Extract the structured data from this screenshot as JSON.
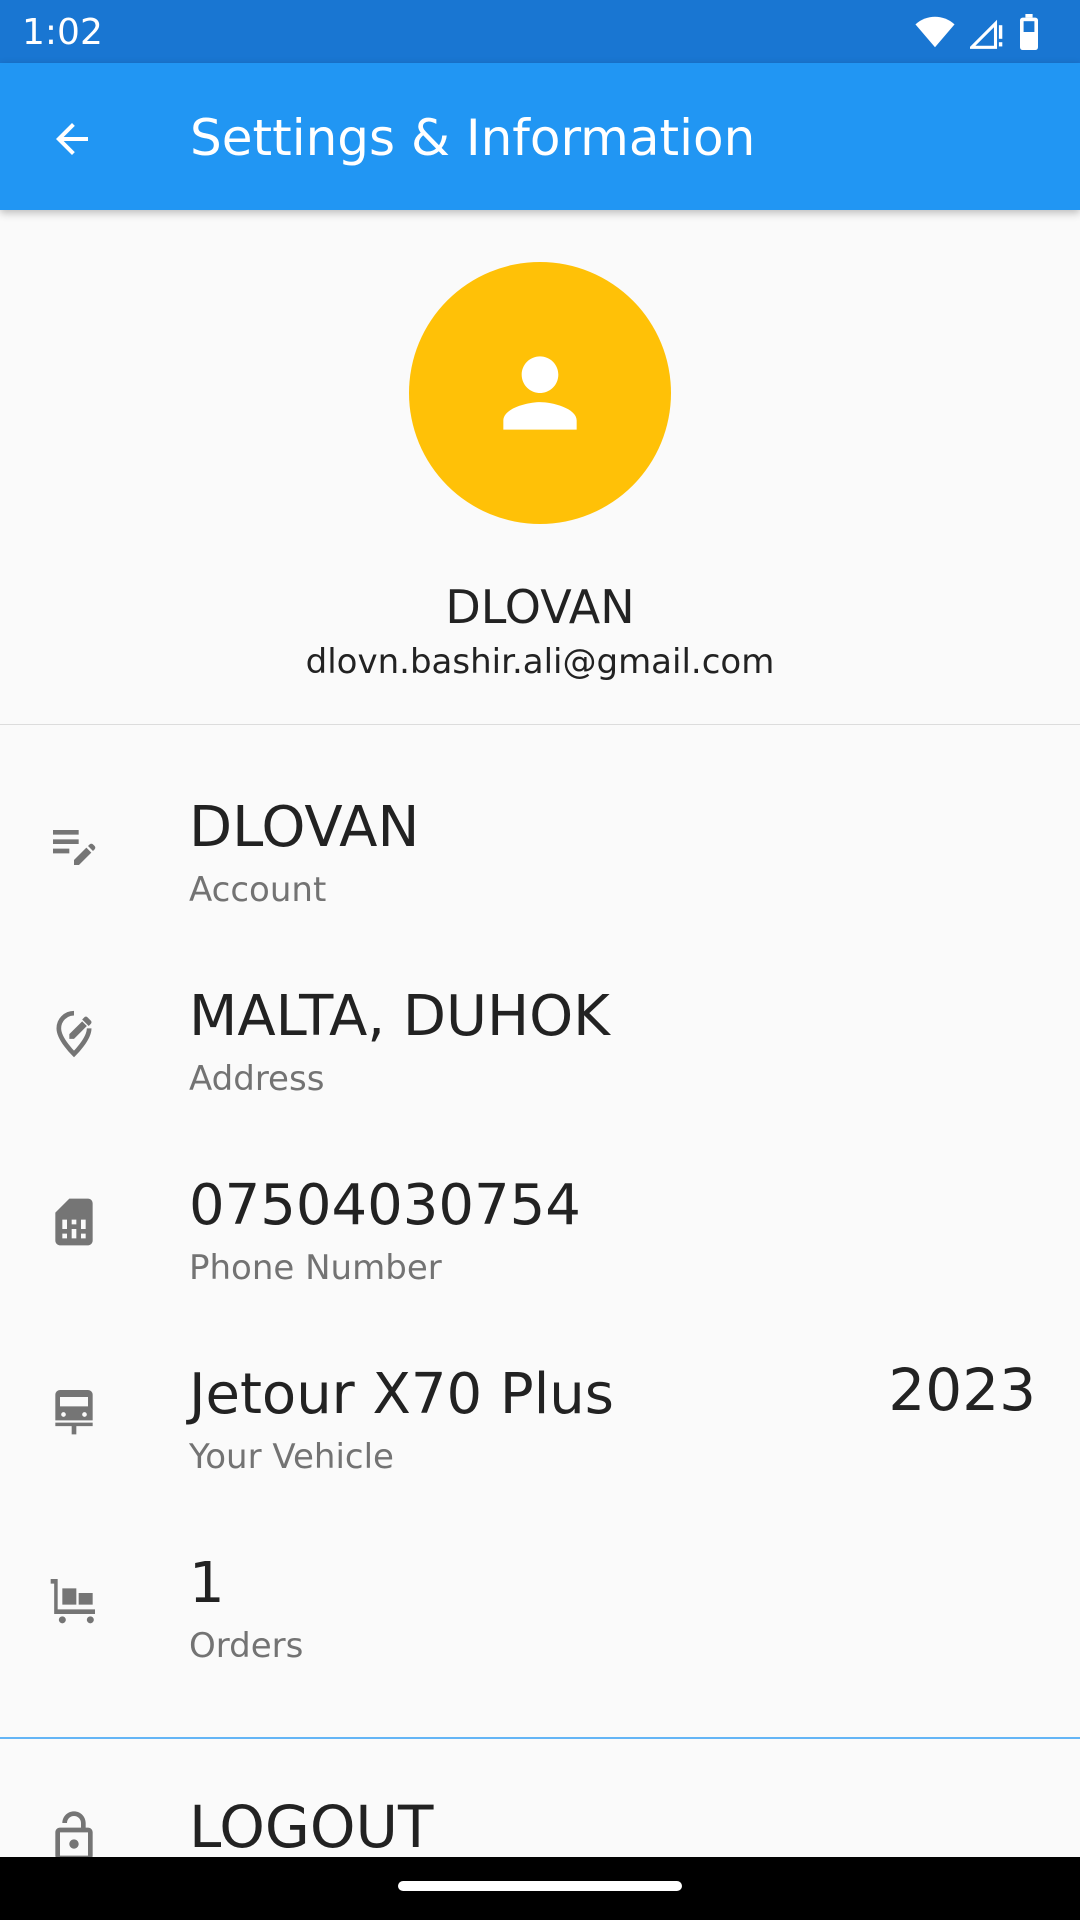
{
  "status_bar": {
    "time": "1:02",
    "icons": [
      "wifi-icon",
      "signal-icon",
      "battery-icon"
    ]
  },
  "app_bar": {
    "title": "Settings & Information",
    "back_icon": "arrow-back-icon",
    "background": "#2196f3"
  },
  "profile": {
    "avatar_icon": "person-icon",
    "avatar_color": "#ffc107",
    "name": "DLOVAN",
    "email": "dlovn.bashir.ali@gmail.com"
  },
  "info_items": [
    {
      "icon": "edit-note-icon",
      "value": "DLOVAN",
      "label": "Account"
    },
    {
      "icon": "edit-location-icon",
      "value": "MALTA, DUHOK",
      "label": "Address"
    },
    {
      "icon": "sim-card-icon",
      "value": "07504030754",
      "label": "Phone Number"
    },
    {
      "icon": "car-icon",
      "value": "Jetour X70 Plus",
      "label": "Your Vehicle",
      "extra": "2023"
    },
    {
      "icon": "cart-icon",
      "value": "1",
      "label": "Orders"
    }
  ],
  "logout": {
    "icon": "lock-icon",
    "label": "LOGOUT"
  }
}
